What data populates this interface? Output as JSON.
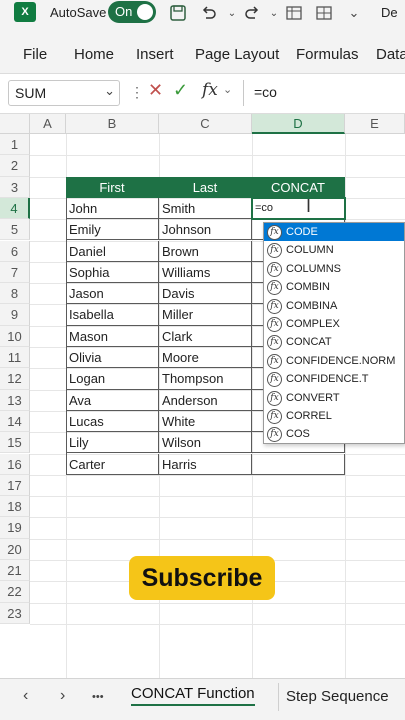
{
  "titlebar": {
    "logo_letter": "X",
    "autosave_label": "AutoSave",
    "toggle_label": "On",
    "doc_name": "De"
  },
  "ribbon": {
    "tabs": [
      "File",
      "Home",
      "Insert",
      "Page Layout",
      "Formulas",
      "Data"
    ]
  },
  "formula_bar": {
    "name_box": "SUM",
    "fx_label": "fx",
    "content": "=co"
  },
  "grid": {
    "columns": [
      "A",
      "B",
      "C",
      "D",
      "E"
    ],
    "rows": [
      "1",
      "2",
      "3",
      "4",
      "5",
      "6",
      "7",
      "8",
      "9",
      "10",
      "11",
      "12",
      "13",
      "14",
      "15",
      "16",
      "17",
      "18",
      "19",
      "20",
      "21",
      "22",
      "23"
    ],
    "table_headers": [
      "First",
      "Last",
      "CONCAT"
    ],
    "table_rows": [
      [
        "John",
        "Smith"
      ],
      [
        "Emily",
        "Johnson"
      ],
      [
        "Daniel",
        "Brown"
      ],
      [
        "Sophia",
        "Williams"
      ],
      [
        "Jason",
        "Davis"
      ],
      [
        "Isabella",
        "Miller"
      ],
      [
        "Mason",
        "Clark"
      ],
      [
        "Olivia",
        "Moore"
      ],
      [
        "Logan",
        "Thompson"
      ],
      [
        "Ava",
        "Anderson"
      ],
      [
        "Lucas",
        "White"
      ],
      [
        "Lily",
        "Wilson"
      ],
      [
        "Carter",
        "Harris"
      ]
    ],
    "active_cell_text": "=co"
  },
  "autocomplete": {
    "items": [
      "CODE",
      "COLUMN",
      "COLUMNS",
      "COMBIN",
      "COMBINA",
      "COMPLEX",
      "CONCAT",
      "CONFIDENCE.NORM",
      "CONFIDENCE.T",
      "CONVERT",
      "CORREL",
      "COS"
    ],
    "selected_index": 0,
    "fx_glyph": "fx"
  },
  "subscribe_label": "Subscribe",
  "sheet_tabs": {
    "items": [
      "CONCAT Function",
      "Step Sequence"
    ],
    "active_index": 0,
    "more_label": "•••"
  },
  "colors": {
    "brand_green": "#1e7145",
    "selection_blue": "#0078d4",
    "subscribe_yellow": "#f5c518"
  }
}
